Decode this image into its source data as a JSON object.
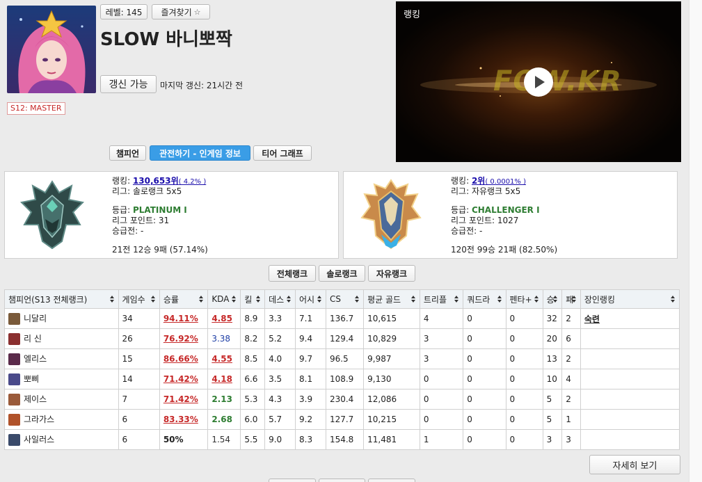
{
  "profile": {
    "level_label": "레벨: 145",
    "favorite_label": "즐겨찾기",
    "summoner_name": "SLOW 바니뽀짝",
    "refresh_label": "갱신 가능",
    "last_update": "마지막 갱신: 21시간 전",
    "season_badge": "S12: MASTER"
  },
  "tabs": [
    {
      "label": "챔피언"
    },
    {
      "label": "관전하기 - 인게임 정보"
    },
    {
      "label": "티어 그래프"
    }
  ],
  "video": {
    "title": "랭킹",
    "logo_text": "FOW.KR"
  },
  "solo": {
    "rank_prefix": "랭킹: ",
    "rank": "130,653위",
    "rank_pct": "( 4.2% )",
    "league": "리그: 솔로랭크 5x5",
    "tier_prefix": "등급: ",
    "tier": "PLATINUM I",
    "points": "리그 포인트: 31",
    "promo": "승급전: -",
    "record": "21전 12승 9패 (57.14%)"
  },
  "flex": {
    "rank_prefix": "랭킹: ",
    "rank": "2위",
    "rank_pct": "( 0.0001% )",
    "league": "리그: 자유랭크 5x5",
    "tier_prefix": "등급: ",
    "tier": "CHALLENGER I",
    "points": "리그 포인트: 1027",
    "promo": "승급전: -",
    "record": "120전 99승 21패 (82.50%)"
  },
  "rank_type_buttons": [
    {
      "label": "전체랭크"
    },
    {
      "label": "솔로랭크"
    },
    {
      "label": "자유랭크"
    }
  ],
  "table": {
    "headers": [
      "챔피언(S13 전체랭크)",
      "게임수",
      "승률",
      "KDA",
      "킬",
      "데스",
      "어시",
      "CS",
      "평균 골드",
      "트리플",
      "쿼드라",
      "펜타+",
      "승",
      "패",
      "장인랭킹"
    ],
    "rows": [
      {
        "champion": "니달리",
        "games": "34",
        "winrate": "94.11%",
        "kda": "4.85",
        "kills": "8.9",
        "deaths": "3.3",
        "assists": "7.1",
        "cs": "136.7",
        "gold": "10,615",
        "triple": "4",
        "quadra": "0",
        "penta": "0",
        "wins": "32",
        "losses": "2",
        "mastery": "숙련",
        "icon_color": "#7a5a3a",
        "wr_style": "red",
        "kda_style": "red"
      },
      {
        "champion": "리 신",
        "games": "26",
        "winrate": "76.92%",
        "kda": "3.38",
        "kills": "8.2",
        "deaths": "5.2",
        "assists": "9.4",
        "cs": "129.4",
        "gold": "10,829",
        "triple": "3",
        "quadra": "0",
        "penta": "0",
        "wins": "20",
        "losses": "6",
        "mastery": "",
        "icon_color": "#8a2f2f",
        "wr_style": "red",
        "kda_style": "blue"
      },
      {
        "champion": "엘리스",
        "games": "15",
        "winrate": "86.66%",
        "kda": "4.55",
        "kills": "8.5",
        "deaths": "4.0",
        "assists": "9.7",
        "cs": "96.5",
        "gold": "9,987",
        "triple": "3",
        "quadra": "0",
        "penta": "0",
        "wins": "13",
        "losses": "2",
        "mastery": "",
        "icon_color": "#5a2a4a",
        "wr_style": "red",
        "kda_style": "red"
      },
      {
        "champion": "뽀삐",
        "games": "14",
        "winrate": "71.42%",
        "kda": "4.18",
        "kills": "6.6",
        "deaths": "3.5",
        "assists": "8.1",
        "cs": "108.9",
        "gold": "9,130",
        "triple": "0",
        "quadra": "0",
        "penta": "0",
        "wins": "10",
        "losses": "4",
        "mastery": "",
        "icon_color": "#4a4a8a",
        "wr_style": "red",
        "kda_style": "red"
      },
      {
        "champion": "제이스",
        "games": "7",
        "winrate": "71.42%",
        "kda": "2.13",
        "kills": "5.3",
        "deaths": "4.3",
        "assists": "3.9",
        "cs": "230.4",
        "gold": "12,086",
        "triple": "0",
        "quadra": "0",
        "penta": "0",
        "wins": "5",
        "losses": "2",
        "mastery": "",
        "icon_color": "#9a5a3a",
        "wr_style": "red",
        "kda_style": "green"
      },
      {
        "champion": "그라가스",
        "games": "6",
        "winrate": "83.33%",
        "kda": "2.68",
        "kills": "6.0",
        "deaths": "5.7",
        "assists": "9.2",
        "cs": "127.7",
        "gold": "10,215",
        "triple": "0",
        "quadra": "0",
        "penta": "0",
        "wins": "5",
        "losses": "1",
        "mastery": "",
        "icon_color": "#b0522a",
        "wr_style": "red",
        "kda_style": "green"
      },
      {
        "champion": "사일러스",
        "games": "6",
        "winrate": "50%",
        "kda": "1.54",
        "kills": "5.5",
        "deaths": "9.0",
        "assists": "8.3",
        "cs": "154.8",
        "gold": "11,481",
        "triple": "1",
        "quadra": "0",
        "penta": "0",
        "wins": "3",
        "losses": "3",
        "mastery": "",
        "icon_color": "#3a4a6a",
        "wr_style": "plain",
        "kda_style": "gray"
      }
    ]
  },
  "detail_button": "자세히 보기",
  "colors": {
    "accent": "#3a9de6",
    "positive": "#c62828",
    "link": "#1a0dab",
    "tier": "#2e7d32"
  }
}
